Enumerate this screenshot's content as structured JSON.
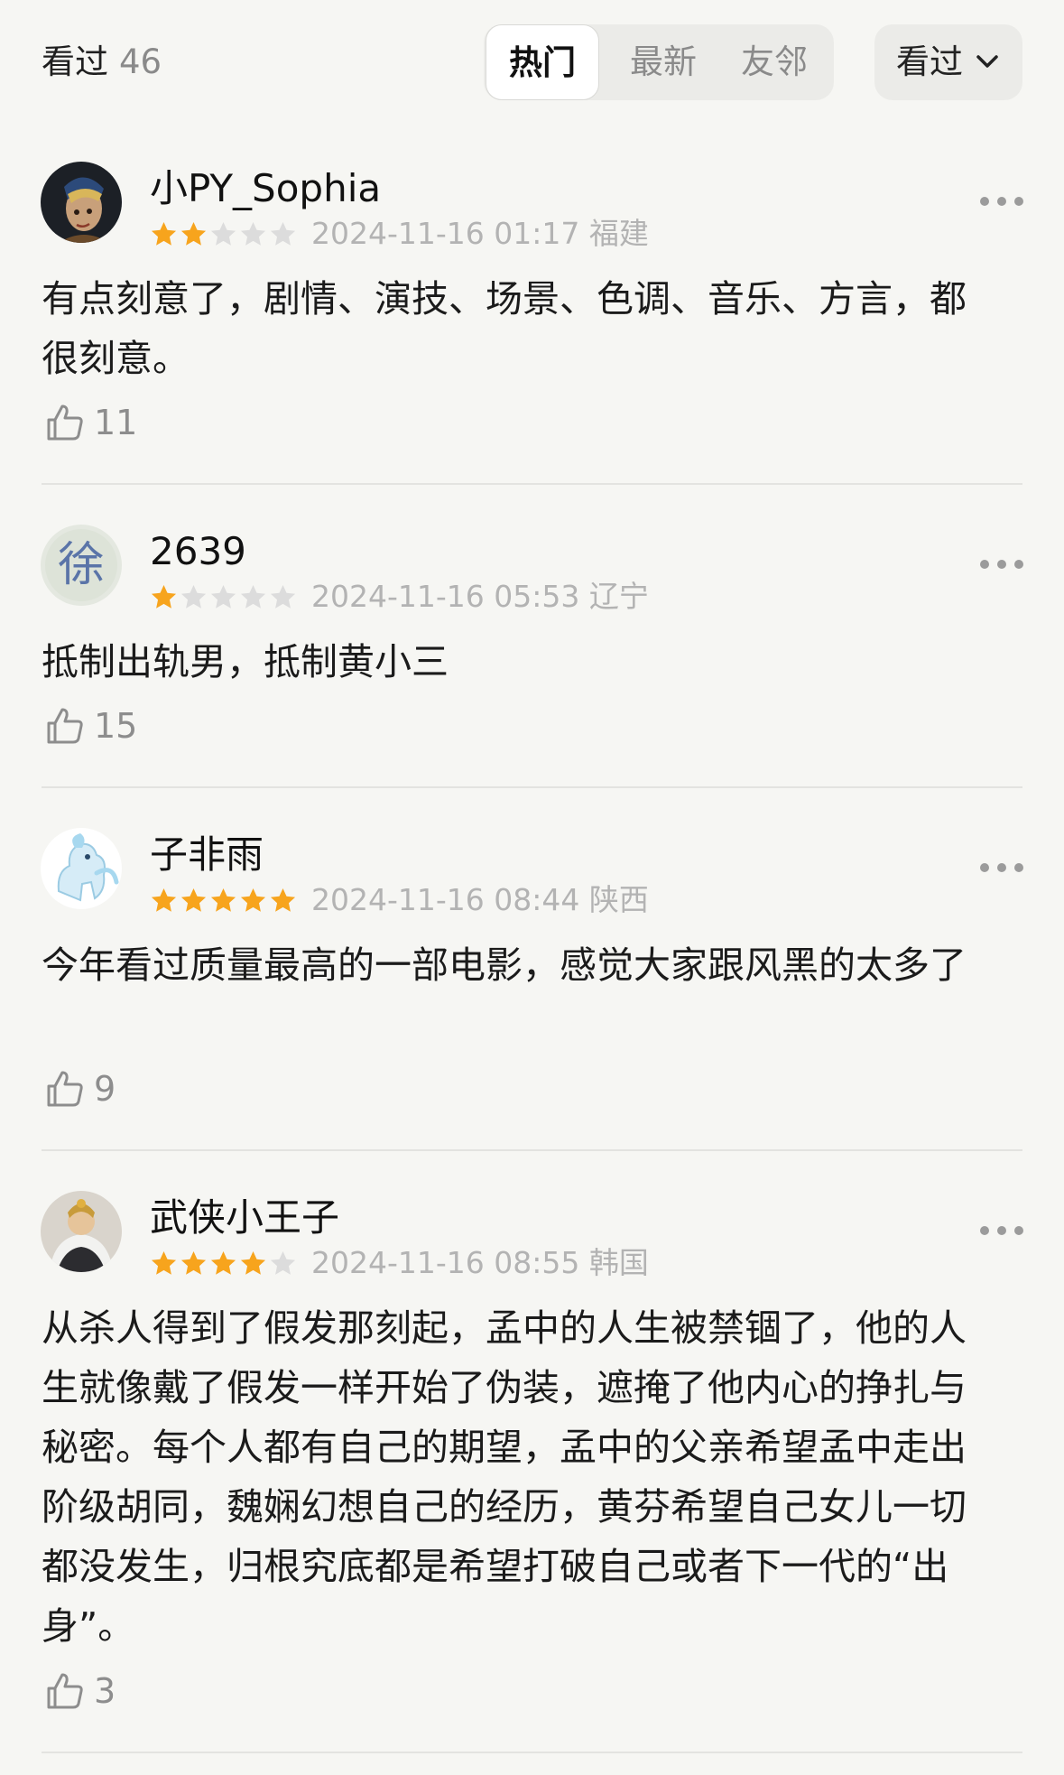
{
  "header": {
    "seen_label": "看过",
    "seen_count": "46",
    "tabs": [
      {
        "label": "热门",
        "active": true
      },
      {
        "label": "最新",
        "active": false
      },
      {
        "label": "友邻",
        "active": false
      }
    ],
    "filter_label": "看过",
    "filter_icon": "chevron-down-icon"
  },
  "colors": {
    "star_on": "#f7a41d",
    "star_off": "#dcdcdc",
    "background": "#f6f6f3"
  },
  "comments": [
    {
      "username": "小PY_Sophia",
      "rating": 2,
      "meta": "2024-11-16 01:17 福建",
      "text": "有点刻意了，剧情、演技、场景、色调、音乐、方言，都很刻意。",
      "likes": "11"
    },
    {
      "username": "2639",
      "rating": 1,
      "meta": "2024-11-16 05:53 辽宁",
      "text": "抵制出轨男，抵制黄小三",
      "likes": "15"
    },
    {
      "username": "子非雨",
      "rating": 5,
      "meta": "2024-11-16 08:44 陕西",
      "text": "今年看过质量最高的一部电影，感觉大家跟风黑的太多了",
      "likes": "9"
    },
    {
      "username": "武侠小王子",
      "rating": 4,
      "meta": "2024-11-16 08:55 韩国",
      "text": "从杀人得到了假发那刻起，孟中的人生被禁锢了，他的人生就像戴了假发一样开始了伪装，遮掩了他内心的挣扎与秘密。每个人都有自己的期望，孟中的父亲希望孟中走出阶级胡同，魏娴幻想自己的经历，黄芬希望自己女儿一切都没发生，归根究底都是希望打破自己或者下一代的“出身”。",
      "likes": "3"
    }
  ]
}
